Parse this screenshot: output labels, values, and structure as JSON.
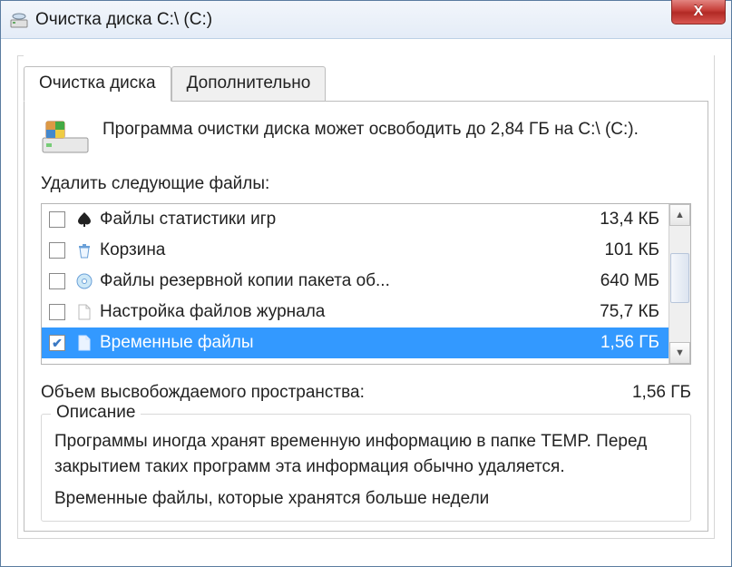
{
  "window": {
    "title": "Очистка диска C:\\ (C:)",
    "close_label": "X"
  },
  "tabs": [
    {
      "label": "Очистка диска",
      "active": true
    },
    {
      "label": "Дополнительно",
      "active": false
    }
  ],
  "intro": "Программа очистки диска может освободить до 2,84 ГБ на C:\\ (C:).",
  "list_heading": "Удалить следующие файлы:",
  "files": [
    {
      "label": "Файлы статистики игр",
      "size": "13,4 КБ",
      "checked": false,
      "selected": false,
      "icon": "spade"
    },
    {
      "label": "Корзина",
      "size": "101 КБ",
      "checked": false,
      "selected": false,
      "icon": "recycle"
    },
    {
      "label": "Файлы резервной копии пакета об...",
      "size": "640 МБ",
      "checked": false,
      "selected": false,
      "icon": "disc"
    },
    {
      "label": "Настройка файлов журнала",
      "size": "75,7 КБ",
      "checked": false,
      "selected": false,
      "icon": "page"
    },
    {
      "label": "Временные файлы",
      "size": "1,56 ГБ",
      "checked": true,
      "selected": true,
      "icon": "page"
    }
  ],
  "total": {
    "label": "Объем высвобождаемого пространства:",
    "value": "1,56 ГБ"
  },
  "description": {
    "title": "Описание",
    "body1": "Программы иногда хранят временную информацию в папке TEMP. Перед закрытием таких программ эта информация обычно удаляется.",
    "body2": "Временные файлы, которые хранятся больше недели"
  }
}
